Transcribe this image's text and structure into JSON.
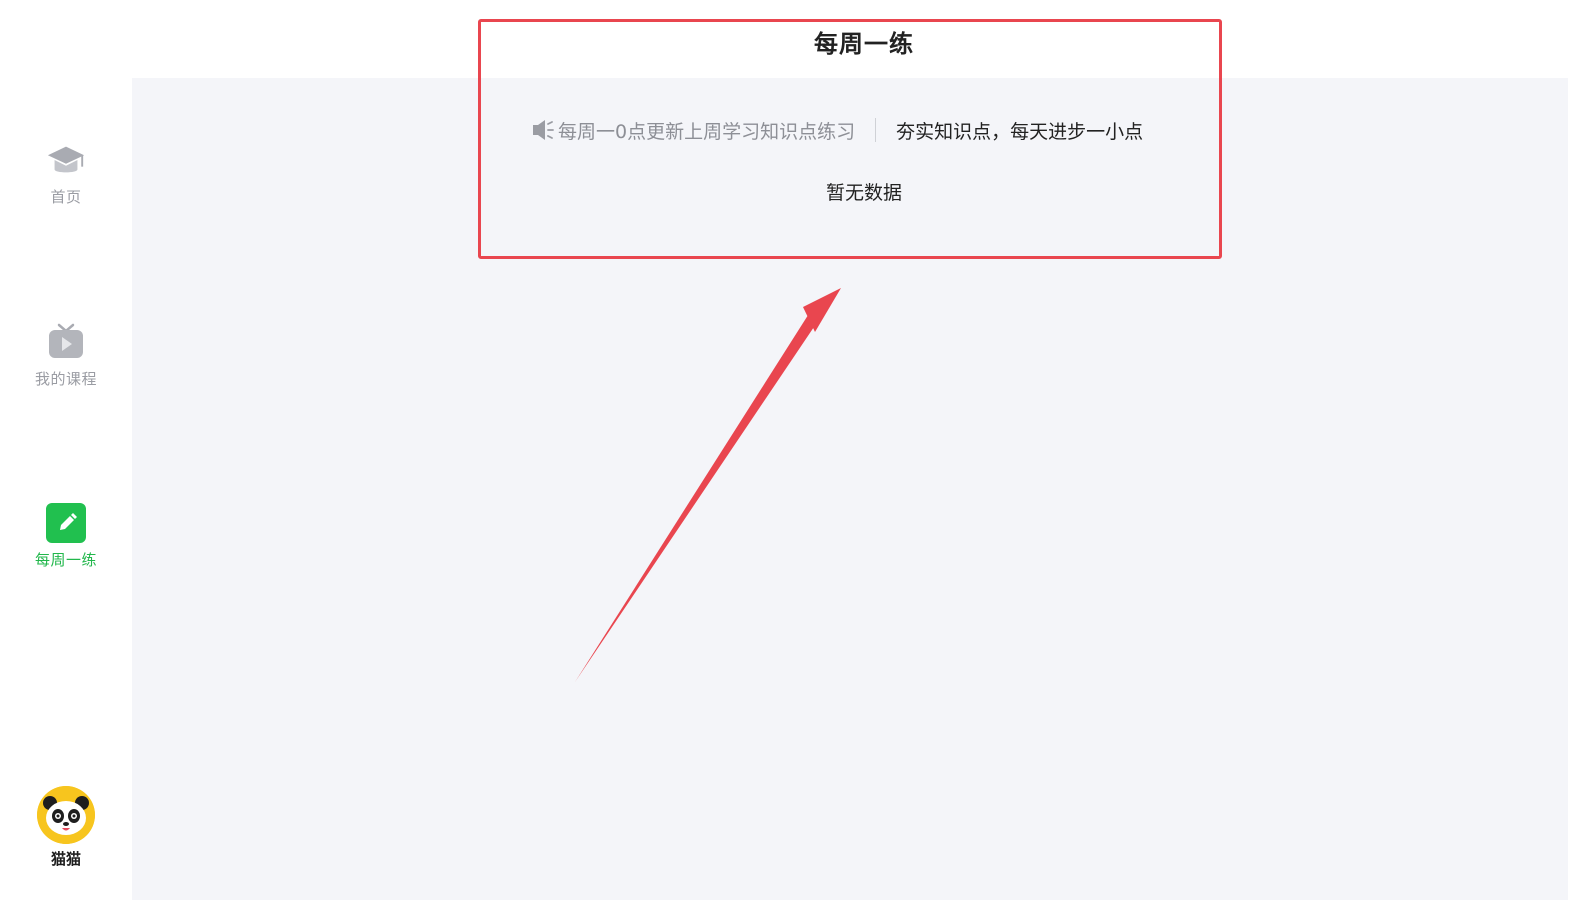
{
  "sidebar": {
    "items": [
      {
        "label": "首页",
        "icon": "graduation-cap-icon",
        "active": false
      },
      {
        "label": "我的课程",
        "icon": "tv-play-icon",
        "active": false
      },
      {
        "label": "每周一练",
        "icon": "pencil-icon",
        "active": true
      }
    ],
    "user": {
      "name": "猫猫",
      "avatar": "panda-avatar-icon"
    }
  },
  "header": {
    "title": "每周一练"
  },
  "main": {
    "notice": {
      "icon": "speaker-icon",
      "text": "每周一0点更新上周学习知识点练习",
      "slogan": "夯实知识点，每天进步一小点"
    },
    "empty_text": "暂无数据"
  },
  "colors": {
    "accent": "#21b74b",
    "inactive": "#9a9ca3",
    "background": "#f4f5f9",
    "annotation": "#e9464f"
  }
}
